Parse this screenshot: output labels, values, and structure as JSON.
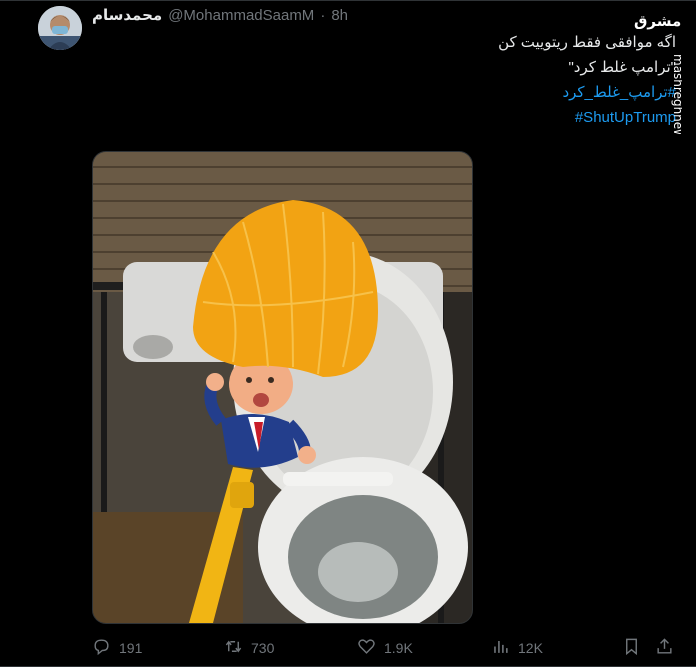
{
  "tweet": {
    "display_name": "محمدسام",
    "handle": "@MohammadSaamM",
    "separator": "·",
    "time": "8h",
    "text_lines": [
      "اگه موافقی فقط ریتوییت کن",
      "\"ترامپ غلط کرد\""
    ],
    "hashtags": [
      "#ترامپ_غلط_کرد",
      "#ShutUpTrump"
    ]
  },
  "watermark": {
    "logo_text": "مشرق",
    "site_text": "mashreghnews.ir"
  },
  "media": {
    "alt_subject": "toilet brush with caricature figure"
  },
  "actions": {
    "reply_count": "191",
    "retweet_count": "730",
    "like_count": "1.9K",
    "views_count": "12K"
  },
  "colors": {
    "background": "#000000",
    "text": "#e7e9ea",
    "muted": "#71767b",
    "link": "#1d9bf0",
    "divider": "#2f3336"
  },
  "icons": {
    "reply": "reply-icon",
    "retweet": "retweet-icon",
    "like": "heart-icon",
    "views": "views-icon",
    "bookmark": "bookmark-icon",
    "share": "share-icon"
  }
}
